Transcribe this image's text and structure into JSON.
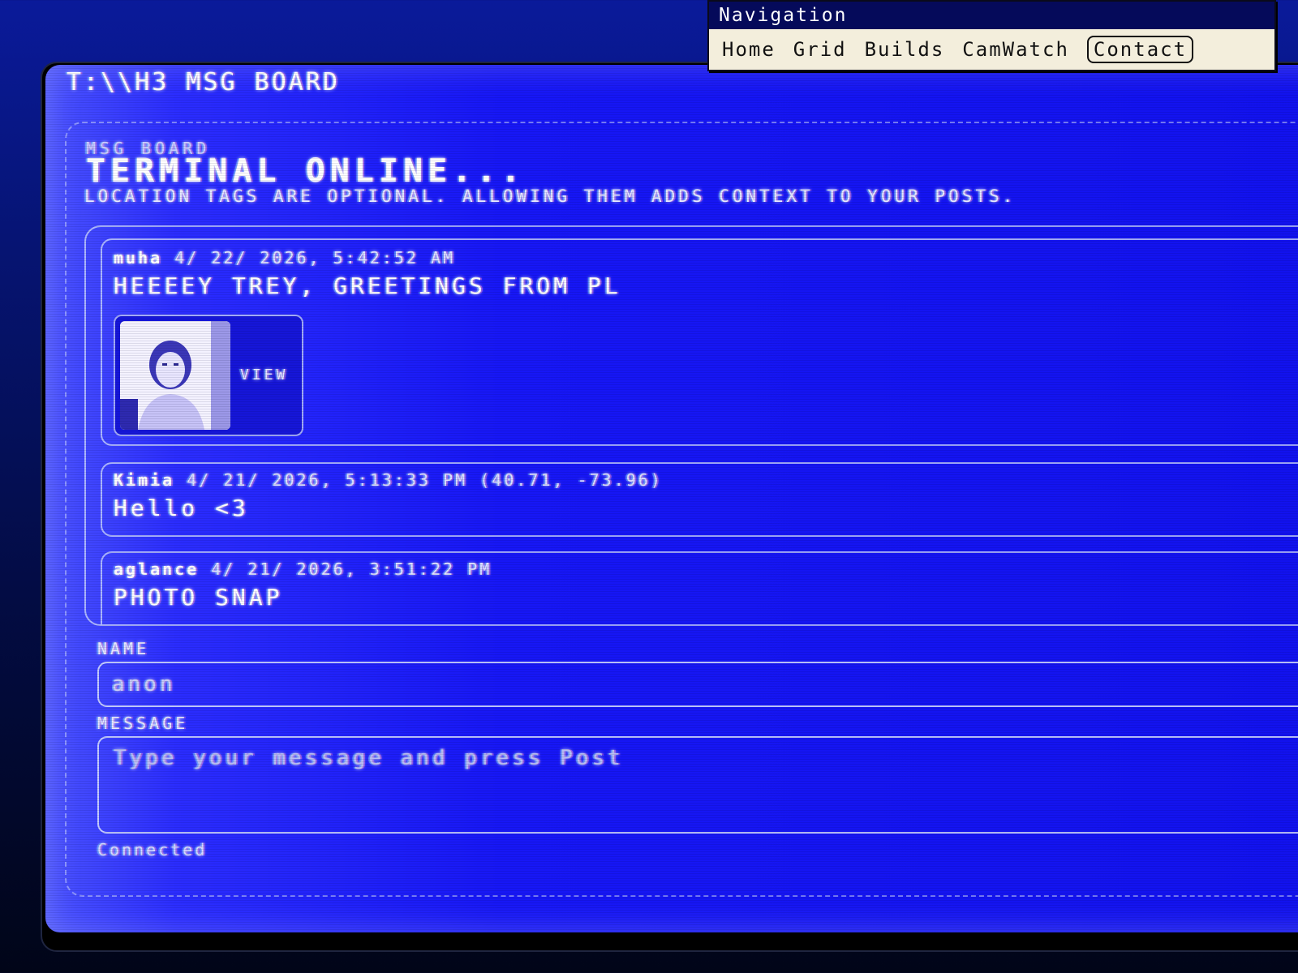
{
  "nav": {
    "title": "Navigation",
    "links": [
      {
        "label": "Home",
        "active": false
      },
      {
        "label": "Grid",
        "active": false
      },
      {
        "label": "Builds",
        "active": false
      },
      {
        "label": "CamWatch",
        "active": false
      },
      {
        "label": "Contact",
        "active": true
      }
    ]
  },
  "screen": {
    "title": "T:\\\\H3 MSG BOARD",
    "eyebrow": "MSG BOARD",
    "headline": "TERMINAL ONLINE...",
    "subtitle": "LOCATION TAGS ARE OPTIONAL. ALLOWING THEM ADDS CONTEXT TO YOUR POSTS."
  },
  "posts": [
    {
      "author": "muha",
      "timestamp": "4/ 22/ 2026, 5:42:52 AM",
      "location": "",
      "message": "HEEEEY TREY, GREETINGS FROM PL",
      "attachment": {
        "view_label": "VIEW",
        "icon": "photo-thumbnail"
      }
    },
    {
      "author": "Kimia",
      "timestamp": "4/ 21/ 2026, 5:13:33 PM",
      "location": "(40.71, -73.96)",
      "message": "Hello <3"
    },
    {
      "author": "aglance",
      "timestamp": "4/ 21/ 2026, 3:51:22 PM",
      "location": "",
      "message": "PHOTO SNAP"
    }
  ],
  "form": {
    "name_label": "NAME",
    "name_value": "anon",
    "message_label": "MESSAGE",
    "message_placeholder": "Type your message and press Post",
    "status": "Connected"
  },
  "colors": {
    "screen_blue": "#1414ee",
    "nav_bg": "#f3eedc",
    "nav_title_bg": "#050a5a",
    "text": "#ffffff"
  }
}
